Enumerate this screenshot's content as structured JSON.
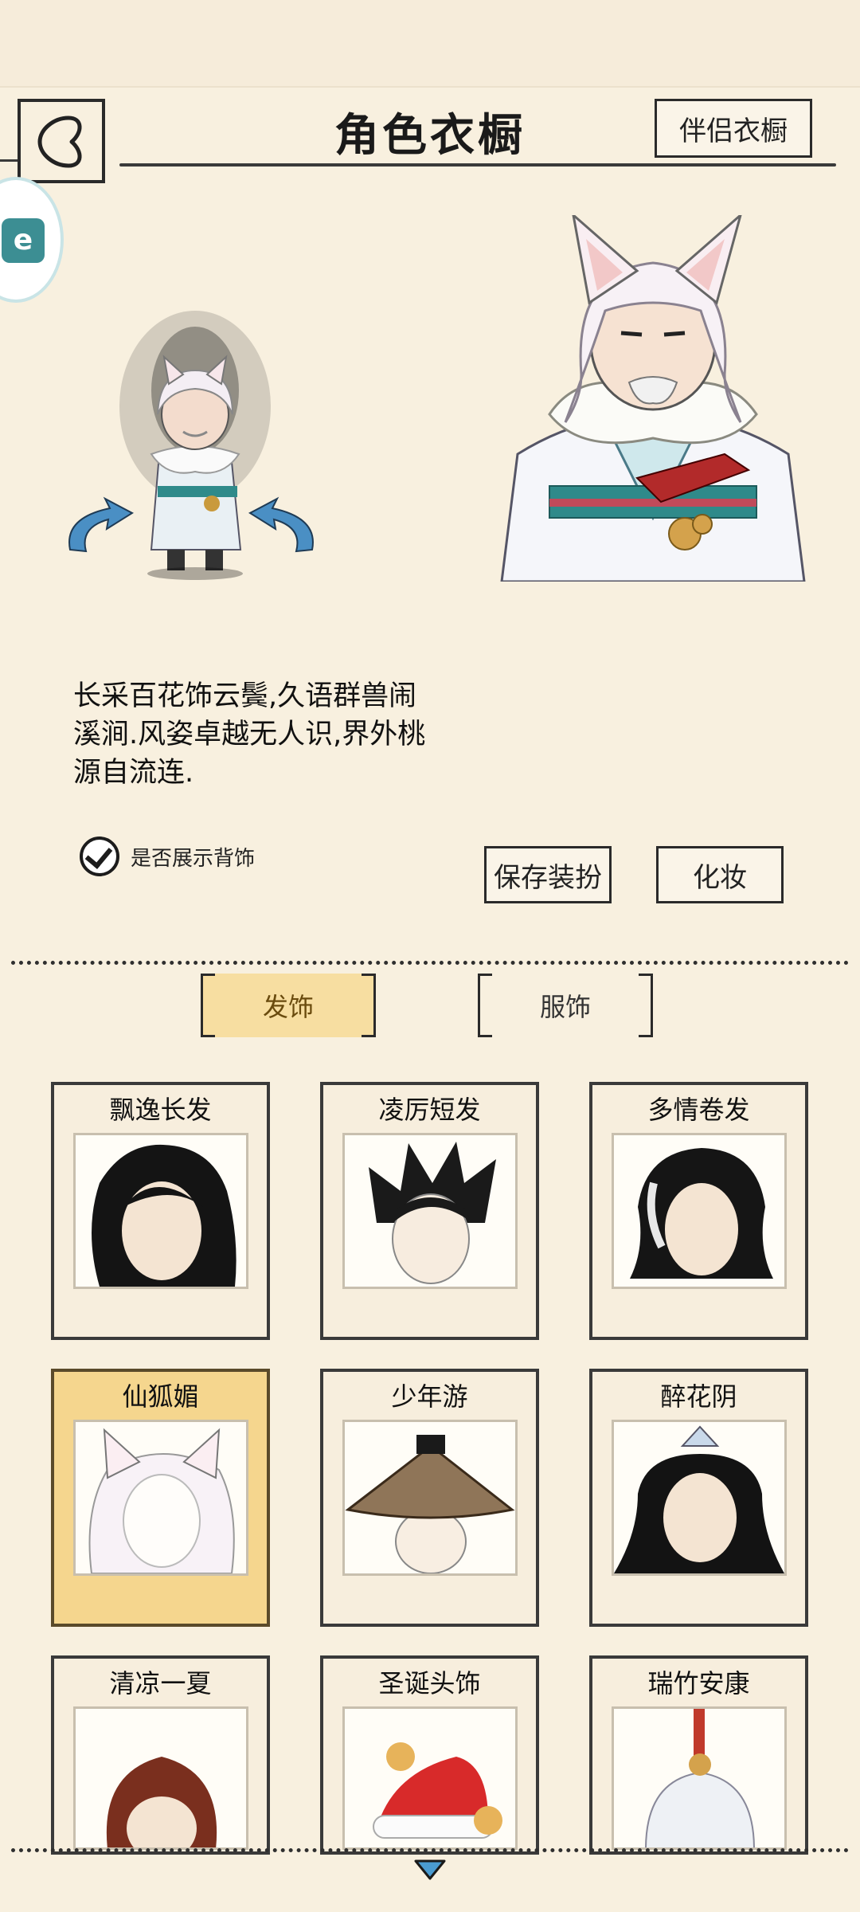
{
  "header": {
    "title": "角色衣橱",
    "partner_button": "伴侣衣橱",
    "side_badge": "e"
  },
  "character": {
    "description": "长采百花饰云鬓,久语群兽闹溪涧.风姿卓越无人识,界外桃源自流连.",
    "show_back_label": "是否展示背饰",
    "show_back_checked": true
  },
  "actions": {
    "save_label": "保存装扮",
    "makeup_label": "化妆"
  },
  "tabs": [
    {
      "label": "发饰",
      "active": true
    },
    {
      "label": "服饰",
      "active": false
    }
  ],
  "items": [
    {
      "name": "飘逸长发",
      "icon": "long-black-hair-icon",
      "selected": false
    },
    {
      "name": "凌厉短发",
      "icon": "spiky-short-hair-icon",
      "selected": false
    },
    {
      "name": "多情卷发",
      "icon": "wavy-hair-icon",
      "selected": false
    },
    {
      "name": "仙狐媚",
      "icon": "fox-ear-white-hair-icon",
      "selected": true
    },
    {
      "name": "少年游",
      "icon": "straw-hat-icon",
      "selected": false
    },
    {
      "name": "醉花阴",
      "icon": "hair-ornament-icon",
      "selected": false
    },
    {
      "name": "清凉一夏",
      "icon": "brown-hair-icon",
      "selected": false
    },
    {
      "name": "圣诞头饰",
      "icon": "santa-hat-icon",
      "selected": false
    },
    {
      "name": "瑞竹安康",
      "icon": "silver-hair-crown-icon",
      "selected": false
    }
  ],
  "colors": {
    "background": "#f8f0df",
    "selected_card": "#f5d68e",
    "active_tab": "#f7dea1",
    "rotate_arrow": "#4a8fc4"
  }
}
